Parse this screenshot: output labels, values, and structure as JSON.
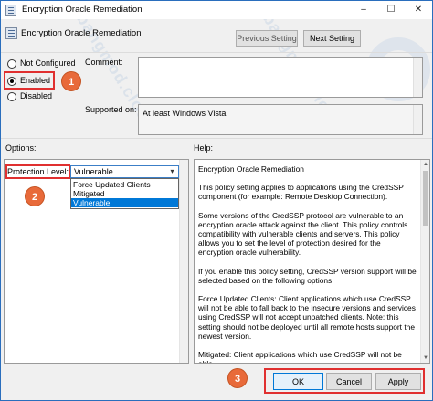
{
  "window": {
    "title": "Encryption Oracle Remediation",
    "controls": {
      "minimize": "–",
      "maximize": "☐",
      "close": "✕"
    }
  },
  "header": {
    "policy_title": "Encryption Oracle Remediation",
    "prev_label": "Previous Setting",
    "next_label": "Next Setting"
  },
  "state": {
    "not_configured": "Not Configured",
    "enabled": "Enabled",
    "disabled": "Disabled",
    "selected": "enabled"
  },
  "comment": {
    "label": "Comment:",
    "value": ""
  },
  "supported": {
    "label": "Supported on:",
    "value": "At least Windows Vista"
  },
  "options": {
    "label": "Options:",
    "protection_label": "Protection Level:",
    "selected_value": "Vulnerable",
    "choices": [
      "Force Updated Clients",
      "Mitigated",
      "Vulnerable"
    ]
  },
  "help": {
    "label": "Help:",
    "paragraphs": [
      "Encryption Oracle Remediation",
      "This policy setting applies to applications using the CredSSP component (for example: Remote Desktop Connection).",
      "Some versions of the CredSSP protocol are vulnerable to an encryption oracle attack against the client. This policy controls compatibility with vulnerable clients and servers. This policy allows you to set the level of protection desired for the encryption oracle vulnerability.",
      "If you enable this policy setting, CredSSP version support will be selected based on the following options:",
      "Force Updated Clients: Client applications which use CredSSP will not be able to fall back to the insecure versions and services using CredSSP will not accept unpatched clients. Note: this setting should not be deployed until all remote hosts support the newest version.",
      "Mitigated: Client applications which use CredSSP will not be able"
    ]
  },
  "footer": {
    "ok_label": "OK",
    "cancel_label": "Cancel",
    "apply_label": "Apply"
  },
  "annotations": {
    "step1": "1",
    "step2": "2",
    "step3": "3"
  },
  "watermark": {
    "text1": "bangmod.cloud",
    "text2": "bangmod.cloud"
  },
  "colors": {
    "highlight": "#e03030",
    "badge": "#e86a3a",
    "selection": "#0078d7"
  }
}
